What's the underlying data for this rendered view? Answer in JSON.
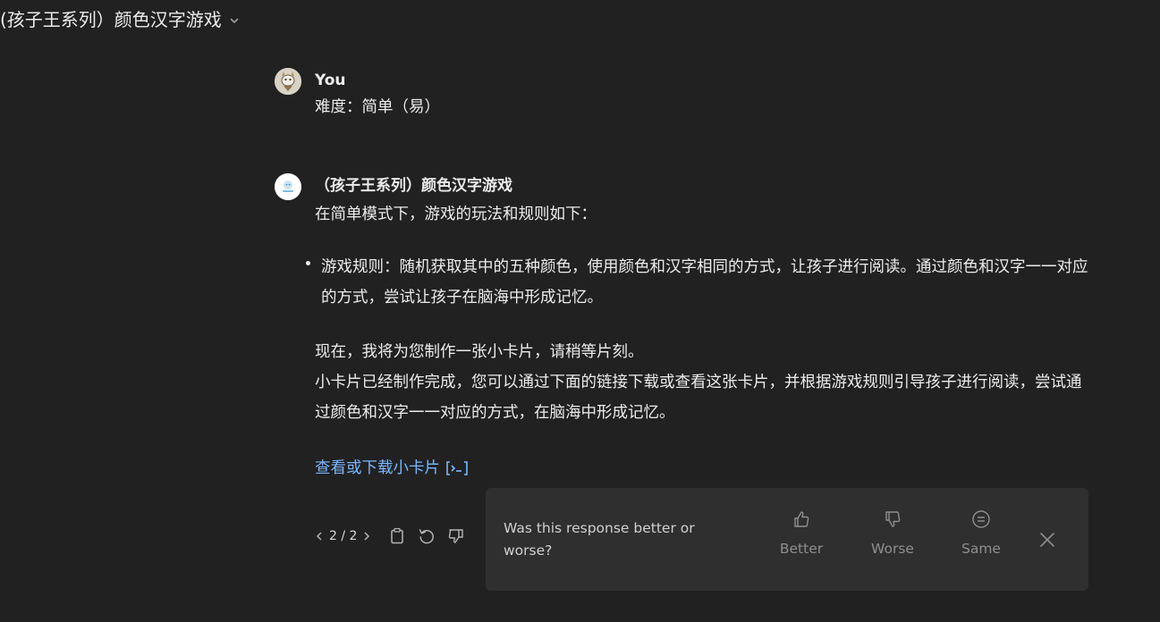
{
  "header": {
    "title": "(孩子王系列）颜色汉字游戏",
    "chevron_icon": "chevron-down-icon"
  },
  "user_message": {
    "author": "You",
    "text": "难度：简单（易）"
  },
  "assistant_message": {
    "author": "（孩子王系列）颜色汉字游戏",
    "intro": "在简单模式下，游戏的玩法和规则如下：",
    "bullet": "游戏规则：随机获取其中的五种颜色，使用颜色和汉字相同的方式，让孩子进行阅读。通过颜色和汉字一一对应的方式，尝试让孩子在脑海中形成记忆。",
    "para_line1": "现在，我将为您制作一张小卡片，请稍等片刻。",
    "para_line2": "小卡片已经制作完成，您可以通过下面的链接下载或查看这张卡片，并根据游戏规则引导孩子进行阅读，尝试通过颜色和汉字一一对应的方式，在脑海中形成记忆。",
    "link_text": "查看或下载小卡片"
  },
  "actions": {
    "pager": "2 / 2",
    "icons": [
      "chevron-left-icon",
      "chevron-right-icon",
      "clipboard-icon",
      "regenerate-icon",
      "thumbs-down-icon"
    ]
  },
  "feedback": {
    "question": "Was this response better or worse?",
    "better": "Better",
    "worse": "Worse",
    "same": "Same"
  },
  "colors": {
    "background": "#212121",
    "panel": "#2f2f2f",
    "text": "#ececec",
    "link": "#7ab7ff",
    "muted": "#8e8e8e"
  }
}
